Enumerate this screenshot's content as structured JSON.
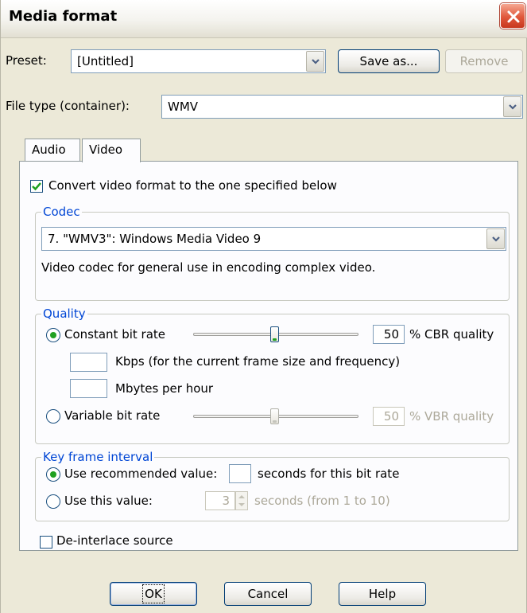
{
  "dialog": {
    "title": "Media format"
  },
  "preset": {
    "label": "Preset:",
    "value": "[Untitled]",
    "save_as_label": "Save as...",
    "remove_label": "Remove"
  },
  "file_type": {
    "label": "File type (container):",
    "value": "WMV"
  },
  "tabs": [
    {
      "label": "Audio",
      "active": false
    },
    {
      "label": "Video",
      "active": true
    }
  ],
  "video": {
    "convert_checkbox_label": "Convert video format to the one specified below",
    "convert_checked": true,
    "codec": {
      "legend": "Codec",
      "value": "7. \"WMV3\": Windows Media Video 9",
      "description": "Video codec for general use in encoding complex video."
    },
    "quality": {
      "legend": "Quality",
      "cbr_label": "Constant bit rate",
      "cbr_selected": true,
      "cbr_value": "50",
      "cbr_unit": "% CBR quality",
      "cbr_slider_fraction": 0.5,
      "kbps_label": "Kbps (for the current frame size and frequency)",
      "mbytes_label": "Mbytes per hour",
      "vbr_label": "Variable bit rate",
      "vbr_selected": false,
      "vbr_value": "50",
      "vbr_unit": "% VBR quality",
      "vbr_slider_fraction": 0.5
    },
    "keyframe": {
      "legend": "Key frame interval",
      "recommended_label": "Use recommended value:",
      "recommended_selected": true,
      "recommended_suffix": "seconds for this bit rate",
      "this_value_label": "Use this value:",
      "this_value": "3",
      "this_value_suffix": "seconds (from 1 to 10)"
    },
    "deinterlace_label": "De-interlace source",
    "deinterlace_checked": false
  },
  "buttons": {
    "ok": "OK",
    "cancel": "Cancel",
    "help": "Help"
  },
  "colors": {
    "accent": "#0046d5",
    "check_green": "#21a121",
    "close_red": "#e0573b"
  }
}
